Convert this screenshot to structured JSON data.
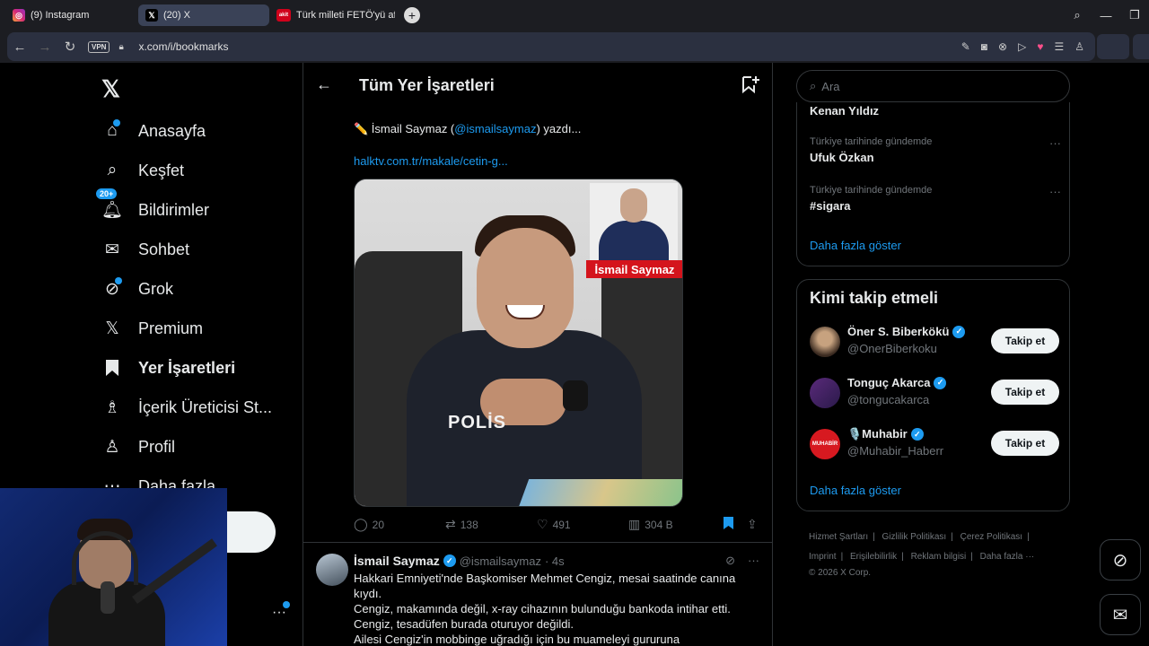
{
  "browser": {
    "tabs": [
      {
        "label": "(9) Instagram",
        "icon": "instagram-icon"
      },
      {
        "label": "(20) X",
        "icon": "x-logo-icon"
      },
      {
        "label": "Türk milleti FETÖ'yü affede",
        "icon": "akit-icon"
      }
    ],
    "vpn_label": "VPN",
    "url": "x.com/i/bookmarks",
    "ak_fav": "akit"
  },
  "nav": {
    "items": [
      {
        "label": "Anasayfa",
        "icon": "home-icon"
      },
      {
        "label": "Keşfet",
        "icon": "search-icon"
      },
      {
        "label": "Bildirimler",
        "icon": "bell-icon",
        "badge": "20+"
      },
      {
        "label": "Sohbet",
        "icon": "mail-icon"
      },
      {
        "label": "Grok",
        "icon": "grok-icon"
      },
      {
        "label": "Premium",
        "icon": "x-logo-icon"
      },
      {
        "label": "Yer İşaretleri",
        "icon": "bookmark-icon"
      },
      {
        "label": "İçerik Üreticisi St...",
        "icon": "creator-studio-icon"
      },
      {
        "label": "Profil",
        "icon": "user-icon"
      },
      {
        "label": "Daha fazla",
        "icon": "more-icon"
      }
    ],
    "post_button_partial": "a"
  },
  "header": {
    "title": "Tüm Yer İşaretleri"
  },
  "tweet1": {
    "prefix": "✏️ İsmail Saymaz (",
    "mention": "@ismailsaymaz",
    "suffix": ") yazdı...",
    "link": "halktv.com.tr/makale/cetin-g...",
    "image_caption": "İsmail Saymaz",
    "image_badge": "POLİS",
    "stats": {
      "replies": "20",
      "reposts": "138",
      "likes": "491",
      "views": "304 B"
    }
  },
  "tweet2": {
    "name": "İsmail Saymaz",
    "handle": "@ismailsaymaz",
    "time": "· 4s",
    "lines": [
      "Hakkari Emniyeti'nde Başkomiser Mehmet Cengiz, mesai saatinde canına",
      "kıydı.",
      "Cengiz, makamında değil, x-ray cihazının bulunduğu bankoda intihar etti.",
      "Cengiz, tesadüfen burada oturuyor değildi.",
      "Ailesi Cengiz'in mobbinge uğradığı için bu muameleyi gururuna"
    ]
  },
  "right": {
    "search_placeholder": "Ara",
    "trend_top": "Kenan Yıldız",
    "trends": [
      {
        "category": "Türkiye tarihinde gündemde",
        "name": "Ufuk Özkan"
      },
      {
        "category": "Türkiye tarihinde gündemde",
        "name": "#sigara"
      }
    ],
    "trends_show_more": "Daha fazla göster",
    "wtf_title": "Kimi takip etmeli",
    "suggestions": [
      {
        "name": "Öner S. Biberkökü",
        "handle": "@OnerBiberkoku",
        "follow": "Takip et"
      },
      {
        "name": "Tonguç Akarca",
        "handle": "@tongucakarca",
        "follow": "Takip et"
      },
      {
        "name": "🎙️Muhabir",
        "handle": "@Muhabir_Haberr",
        "follow": "Takip et"
      }
    ],
    "wtf_show_more": "Daha fazla göster",
    "muhabir_avatar_text": "MUHABİR"
  },
  "footer": {
    "links": [
      "Hizmet Şartları",
      "|",
      "Gizlilik Politikası",
      "|",
      "Çerez Politikası",
      "|",
      "Imprint",
      "|",
      "Erişilebilirlik",
      "|",
      "Reklam bilgisi",
      "|",
      "Daha fazla ···"
    ],
    "copyright": "© 2026 X Corp."
  },
  "colors": {
    "accent": "#1d9bf0",
    "background": "#000000",
    "border": "#2f3336",
    "muted_text": "#71767b"
  }
}
